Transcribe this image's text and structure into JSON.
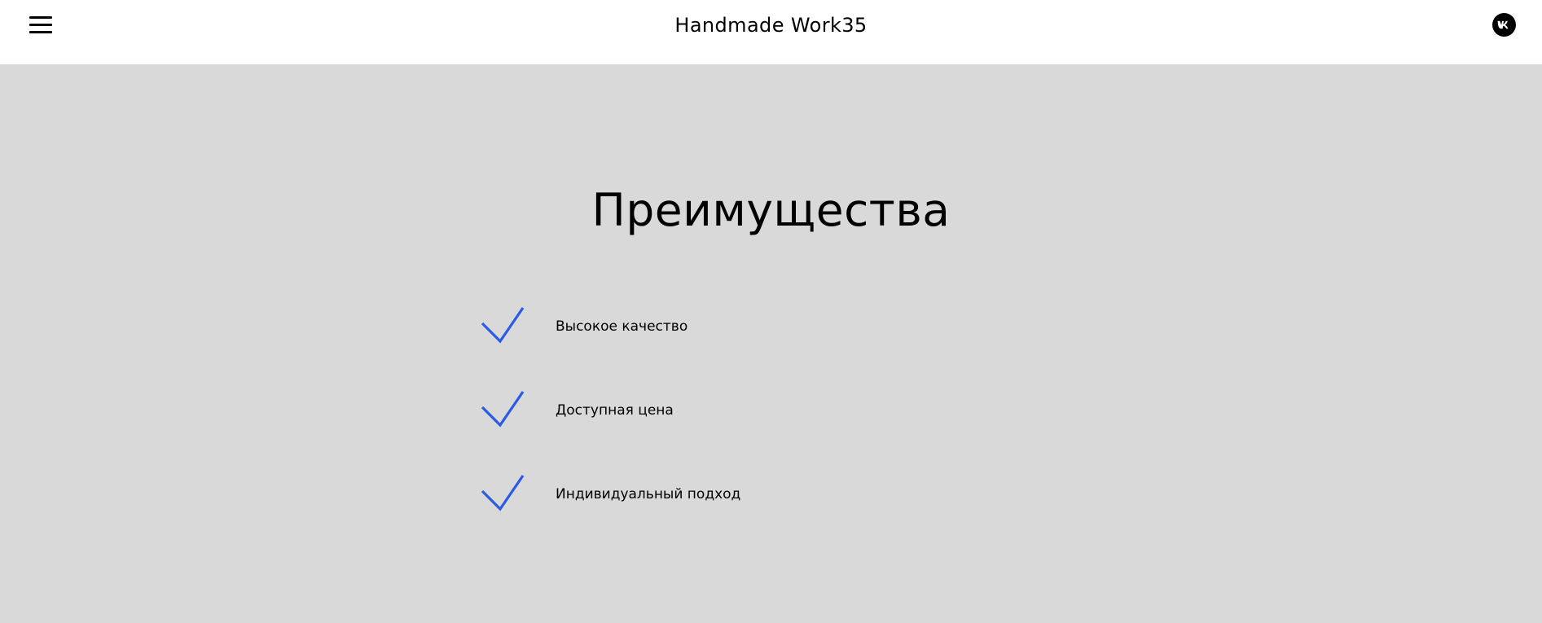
{
  "header": {
    "menu_icon": "hamburger-menu-icon",
    "title": "Handmade Work35",
    "social_icon": "vk-icon"
  },
  "advantages": {
    "title": "Преимущества",
    "check_icon": "checkmark-icon",
    "check_color": "#2a5be8",
    "items": [
      {
        "label": "Высокое качество"
      },
      {
        "label": "Доступная цена"
      },
      {
        "label": "Индивидуальный подход"
      }
    ]
  },
  "colors": {
    "header_bg": "#ffffff",
    "section_bg": "#d9d9d9",
    "text": "#000000",
    "accent": "#2a5be8"
  }
}
